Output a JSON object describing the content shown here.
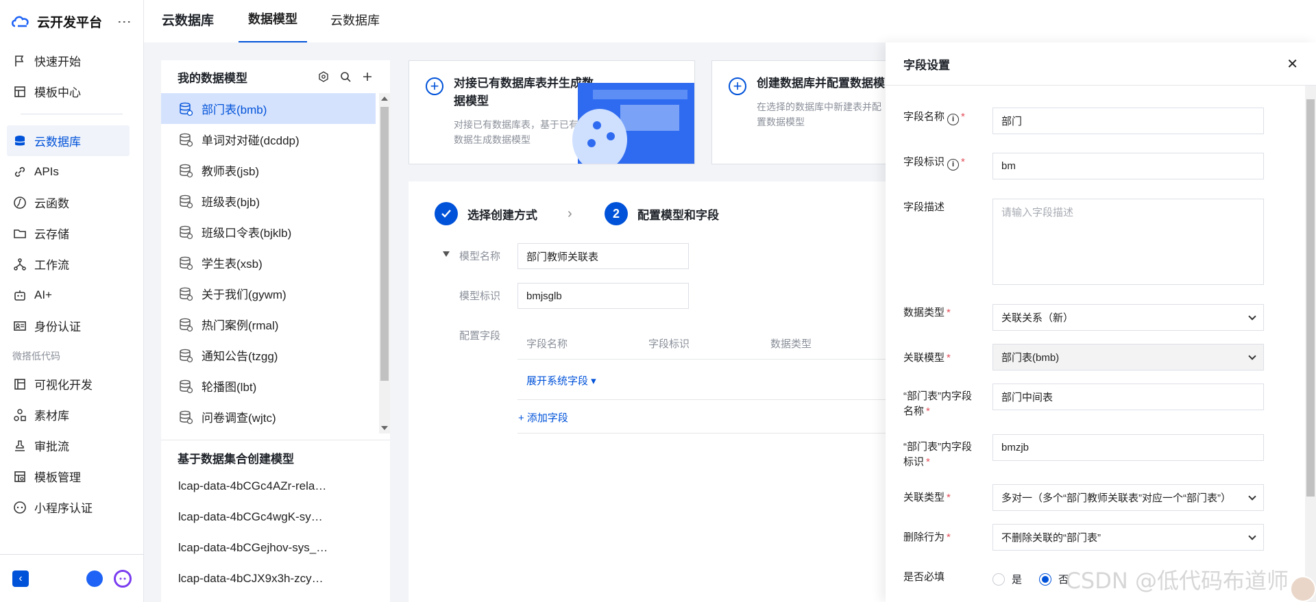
{
  "brand": {
    "title": "云开发平台"
  },
  "nav": {
    "items_top": [
      {
        "label": "快速开始",
        "icon": "flag-icon"
      },
      {
        "label": "模板中心",
        "icon": "template-icon"
      }
    ],
    "items_main": [
      {
        "label": "云数据库",
        "icon": "database-icon",
        "active": true
      },
      {
        "label": "APIs",
        "icon": "link-icon"
      },
      {
        "label": "云函数",
        "icon": "function-icon"
      },
      {
        "label": "云存储",
        "icon": "folder-icon"
      },
      {
        "label": "工作流",
        "icon": "workflow-icon"
      },
      {
        "label": "AI+",
        "icon": "robot-icon"
      },
      {
        "label": "身份认证",
        "icon": "id-card-icon"
      }
    ],
    "group_label": "微搭低代码",
    "items_lowcode": [
      {
        "label": "可视化开发",
        "icon": "layout-icon"
      },
      {
        "label": "素材库",
        "icon": "assets-icon"
      },
      {
        "label": "审批流",
        "icon": "stamp-icon"
      },
      {
        "label": "模板管理",
        "icon": "template-manage-icon"
      },
      {
        "label": "小程序认证",
        "icon": "miniprogram-icon"
      }
    ]
  },
  "topbar": {
    "crumb": "云数据库",
    "tabs": [
      {
        "label": "数据模型",
        "active": true
      },
      {
        "label": "云数据库",
        "active": false
      }
    ]
  },
  "models": {
    "title": "我的数据模型",
    "items": [
      "部门表(bmb)",
      "单词对对碰(dcddp)",
      "教师表(jsb)",
      "班级表(bjb)",
      "班级口令表(bjklb)",
      "学生表(xsb)",
      "关于我们(gywm)",
      "热门案例(rmal)",
      "通知公告(tzgg)",
      "轮播图(lbt)",
      "问卷调查(wjtc)"
    ],
    "dataset_title": "基于数据集合创建模型",
    "datasets": [
      "lcap-data-4bCGc4AZr-rela…",
      "lcap-data-4bCGc4wgK-sy…",
      "lcap-data-4bCGejhov-sys_…",
      "lcap-data-4bCJX9x3h-zcy…"
    ]
  },
  "cards": [
    {
      "title": "对接已有数据库表并生成数据模型",
      "desc": "对接已有数据库表，基于已有的数据生成数据模型"
    },
    {
      "title": "创建数据库并配置数据模",
      "desc": "在选择的数据库中新建表并配置数据模型"
    }
  ],
  "wizard": {
    "step1": "选择创建方式",
    "step2_num": "2",
    "step2": "配置模型和字段",
    "model_name_label": "模型名称",
    "model_name_value": "部门教师关联表",
    "model_id_label": "模型标识",
    "model_id_value": "bmjsglb",
    "config_label": "配置字段",
    "col_name": "字段名称",
    "col_id": "字段标识",
    "col_type": "数据类型",
    "expand_link": "展开系统字段 ▾",
    "add_link": "+ 添加字段"
  },
  "drawer": {
    "title": "字段设置",
    "field_name_label": "字段名称",
    "field_name_value": "部门",
    "field_id_label": "字段标识",
    "field_id_value": "bm",
    "desc_label": "字段描述",
    "desc_placeholder": "请输入字段描述",
    "type_label": "数据类型",
    "type_value": "关联关系（新）",
    "rel_model_label": "关联模型",
    "rel_model_value": "部门表(bmb)",
    "inner_name_label": "“部门表”内字段名称",
    "inner_name_value": "部门中间表",
    "inner_id_label": "“部门表”内字段标识",
    "inner_id_value": "bmzjb",
    "rel_type_label": "关联类型",
    "rel_type_value": "多对一（多个“部门教师关联表”对应一个“部门表”）",
    "delete_label": "删除行为",
    "delete_value": "不删除关联的“部门表”",
    "required_label": "是否必填",
    "required_yes": "是",
    "required_no": "否"
  },
  "watermark": "CSDN @低代码布道师",
  "colors": {
    "accent": "#0052d9",
    "required": "#e34d59"
  }
}
